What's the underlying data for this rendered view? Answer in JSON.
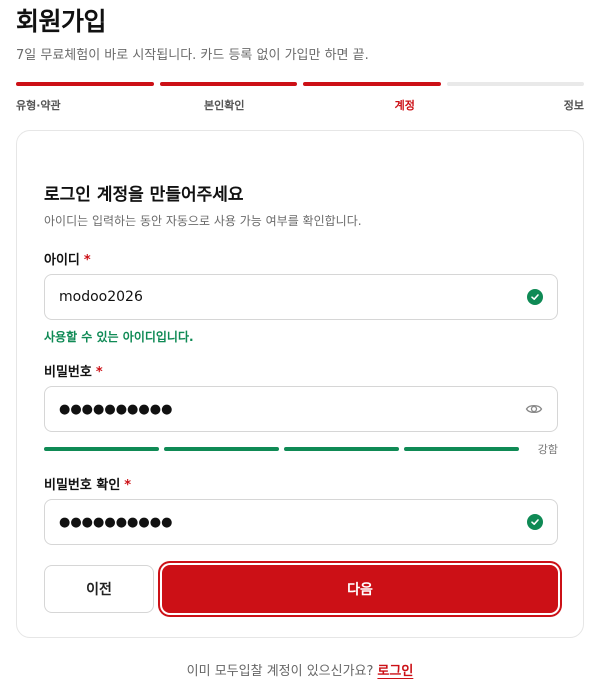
{
  "header": {
    "title": "회원가입",
    "subtitle": "7일 무료체험이 바로 시작됩니다. 카드 등록 없이 가입만 하면 끝."
  },
  "steps": [
    {
      "label": "유형·약관",
      "done": true,
      "active": false
    },
    {
      "label": "본인확인",
      "done": true,
      "active": false
    },
    {
      "label": "계정",
      "done": true,
      "active": true
    },
    {
      "label": "정보",
      "done": false,
      "active": false
    }
  ],
  "card": {
    "title": "로그인 계정을 만들어주세요",
    "description": "아이디는 입력하는 동안 자동으로 사용 가능 여부를 확인합니다."
  },
  "fields": {
    "id": {
      "label": "아이디",
      "required_mark": "*",
      "value": "modoo2026",
      "status_icon": "check-circle-icon",
      "help": "사용할 수 있는 아이디입니다."
    },
    "password": {
      "label": "비밀번호",
      "required_mark": "*",
      "value": "●●●●●●●●●●",
      "action_icon": "eye-icon",
      "strength_label": "강함",
      "strength_level": 4,
      "strength_max": 4
    },
    "password_confirm": {
      "label": "비밀번호 확인",
      "required_mark": "*",
      "value": "●●●●●●●●●●",
      "status_icon": "check-circle-icon"
    }
  },
  "buttons": {
    "prev": "이전",
    "next": "다음"
  },
  "footer": {
    "text": "이미 모두입찰 계정이 있으신가요?",
    "login_link": "로그인"
  },
  "colors": {
    "accent": "#cc1016",
    "success": "#0f8a55"
  }
}
